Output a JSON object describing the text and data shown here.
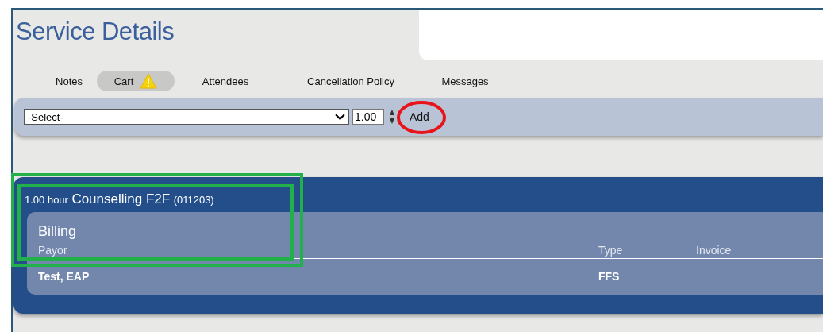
{
  "window": {
    "title": "Service Details"
  },
  "tabs": [
    {
      "label": "Notes",
      "selected": false,
      "warning": false
    },
    {
      "label": "Cart",
      "selected": true,
      "warning": true
    },
    {
      "label": "Attendees",
      "selected": false,
      "warning": false
    },
    {
      "label": "Cancellation Policy",
      "selected": false,
      "warning": false
    },
    {
      "label": "Messages",
      "selected": false,
      "warning": false
    }
  ],
  "toolbar": {
    "service_select": {
      "value": "-Select-"
    },
    "quantity": {
      "value": "1.00"
    },
    "add_button": "Add"
  },
  "service": {
    "quantity": "1.00",
    "unit": "hour",
    "name": "Counselling F2F",
    "code": "(011203)",
    "billing": {
      "title": "Billing",
      "columns": [
        "Payor",
        "Type",
        "Invoice"
      ],
      "rows": [
        [
          "Test, EAP",
          "FFS",
          ""
        ]
      ]
    }
  },
  "annotations": [
    {
      "kind": "ellipse",
      "color": "#e8141c"
    },
    {
      "kind": "box",
      "color": "#22b04a"
    },
    {
      "kind": "box",
      "color": "#22b04a"
    }
  ]
}
